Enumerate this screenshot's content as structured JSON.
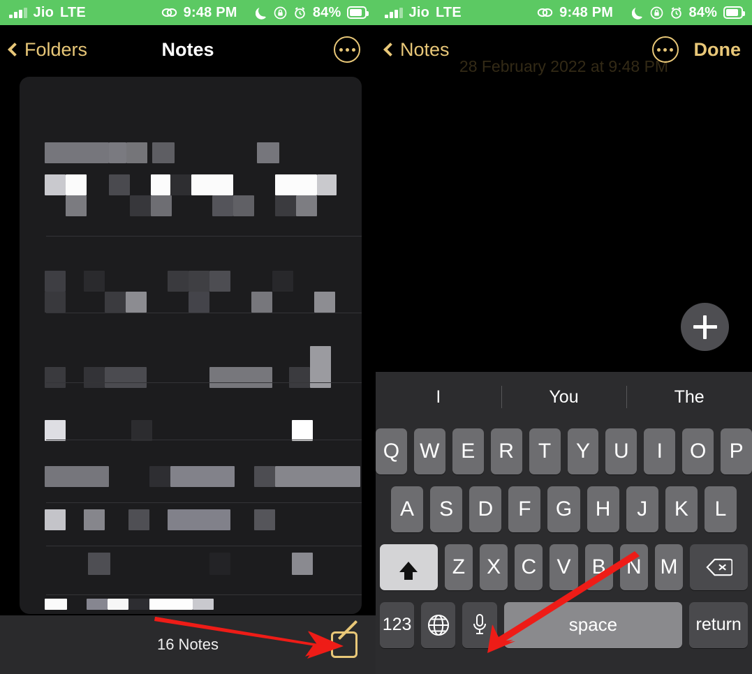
{
  "status_bar": {
    "carrier": "Jio",
    "network": "LTE",
    "time": "9:48 PM",
    "battery_percent": "84%",
    "battery_level": 84,
    "icons": [
      "signal-bars-icon",
      "link-icon",
      "moon-icon",
      "rotation-lock-icon",
      "alarm-icon",
      "battery-icon"
    ],
    "background_color": "#5cc963"
  },
  "left_pane": {
    "nav": {
      "back_label": "Folders",
      "title": "Notes",
      "more_icon": "more-options-icon"
    },
    "bottom": {
      "count_label": "16 Notes",
      "compose_icon": "compose-note-icon"
    },
    "note_rows": 9
  },
  "right_pane": {
    "nav": {
      "back_label": "Notes",
      "more_icon": "more-options-icon",
      "done_label": "Done"
    },
    "note_date": "28 February 2022 at 9:48 PM",
    "fab_icon": "add-icon"
  },
  "keyboard": {
    "suggestions": [
      "I",
      "You",
      "The"
    ],
    "row1": [
      "Q",
      "W",
      "E",
      "R",
      "T",
      "Y",
      "U",
      "I",
      "O",
      "P"
    ],
    "row2": [
      "A",
      "S",
      "D",
      "F",
      "G",
      "H",
      "J",
      "K",
      "L"
    ],
    "row3": [
      "Z",
      "X",
      "C",
      "V",
      "B",
      "N",
      "M"
    ],
    "shift_label": "shift",
    "delete_label": "delete",
    "numeric_label": "123",
    "globe_label": "next-keyboard",
    "dictation_label": "dictation",
    "space_label": "space",
    "return_label": "return",
    "shift_active": true
  },
  "annotations": {
    "arrow_color": "#ee1c17",
    "arrow_1_target": "compose-note-icon",
    "arrow_2_target": "dictation-key"
  },
  "colors": {
    "accent": "#e8c778",
    "status_green": "#5cc963",
    "list_bg": "#1c1c1e",
    "keyboard_bg": "#2c2c2e",
    "key_bg": "#6d6d70"
  },
  "blurred_blocks": [
    {
      "r": 0,
      "t": 46,
      "items": [
        [
          36,
          48,
          92,
          30,
          "#76767c"
        ],
        [
          128,
          48,
          25,
          30,
          "#7a7a80"
        ],
        [
          153,
          48,
          30,
          30,
          "#757579"
        ],
        [
          190,
          48,
          32,
          30,
          "#5e5e63"
        ],
        [
          340,
          48,
          32,
          30,
          "#76767c"
        ]
      ]
    },
    {
      "r": 0,
      "t": 0,
      "items": []
    },
    {
      "r": 1,
      "t": 140,
      "items": [
        [
          36,
          0,
          30,
          30,
          "#c9c9ce"
        ],
        [
          66,
          0,
          30,
          30,
          "#fbfbfb"
        ],
        [
          66,
          30,
          30,
          30,
          "#7b7b80"
        ],
        [
          128,
          0,
          30,
          30,
          "#4a4a4f"
        ],
        [
          158,
          30,
          30,
          30,
          "#37373b"
        ],
        [
          188,
          30,
          30,
          30,
          "#6e6e73"
        ],
        [
          188,
          0,
          28,
          30,
          "#fcfcfc"
        ],
        [
          216,
          0,
          30,
          30,
          "#2e2e31"
        ],
        [
          246,
          0,
          60,
          30,
          "#fbfbfb"
        ],
        [
          276,
          30,
          30,
          30,
          "#54545a"
        ],
        [
          306,
          30,
          30,
          30,
          "#606065"
        ],
        [
          366,
          0,
          60,
          30,
          "#fcfcfc"
        ],
        [
          426,
          0,
          28,
          30,
          "#c9c9cd"
        ],
        [
          366,
          30,
          30,
          30,
          "#3b3b3f"
        ],
        [
          396,
          30,
          30,
          30,
          "#7d7d82"
        ]
      ]
    },
    {
      "r": 2,
      "t": 278,
      "items": [
        [
          36,
          0,
          30,
          30,
          "#3e3e43"
        ],
        [
          36,
          30,
          30,
          30,
          "#39393d"
        ],
        [
          92,
          0,
          30,
          30,
          "#2a2a2d"
        ],
        [
          122,
          30,
          30,
          30,
          "#3b3b3f"
        ],
        [
          152,
          30,
          30,
          30,
          "#8c8c91"
        ],
        [
          212,
          0,
          30,
          30,
          "#3a3a3e"
        ],
        [
          242,
          0,
          30,
          30,
          "#3f3f43"
        ],
        [
          272,
          0,
          30,
          30,
          "#4d4d52"
        ],
        [
          242,
          30,
          30,
          30,
          "#44444a"
        ],
        [
          332,
          30,
          30,
          30,
          "#77777c"
        ],
        [
          362,
          0,
          30,
          30,
          "#28282b"
        ],
        [
          422,
          30,
          30,
          30,
          "#8d8d92"
        ]
      ]
    },
    {
      "r": 3,
      "t": 416,
      "items": [
        [
          36,
          0,
          30,
          30,
          "#3a3a3e"
        ],
        [
          92,
          0,
          30,
          30,
          "#333337"
        ],
        [
          122,
          0,
          60,
          30,
          "#4b4b50"
        ],
        [
          272,
          0,
          90,
          30,
          "#77777c"
        ],
        [
          386,
          0,
          30,
          30,
          "#3b3b3f"
        ],
        [
          416,
          -30,
          30,
          60,
          "#9b9ba0"
        ]
      ]
    },
    {
      "r": 4,
      "t": 492,
      "items": [
        [
          36,
          0,
          30,
          30,
          "#dedee3"
        ],
        [
          160,
          0,
          30,
          30,
          "#2c2c2f"
        ],
        [
          390,
          0,
          30,
          30,
          "#ffffff"
        ]
      ]
    },
    {
      "r": 5,
      "t": 558,
      "items": [
        [
          36,
          0,
          92,
          30,
          "#76767c"
        ],
        [
          186,
          0,
          30,
          30,
          "#2e2e32"
        ],
        [
          216,
          0,
          92,
          30,
          "#82828a"
        ],
        [
          336,
          0,
          30,
          30,
          "#4d4d52"
        ],
        [
          366,
          0,
          122,
          30,
          "#86868c"
        ]
      ]
    },
    {
      "r": 6,
      "t": 620,
      "items": [
        [
          36,
          0,
          30,
          30,
          "#c4c4c9"
        ],
        [
          92,
          0,
          30,
          30,
          "#86868c"
        ],
        [
          156,
          0,
          30,
          30,
          "#4f4f54"
        ],
        [
          212,
          0,
          90,
          30,
          "#81818a"
        ],
        [
          336,
          0,
          30,
          30,
          "#55555a"
        ]
      ]
    },
    {
      "r": 7,
      "t": 682,
      "items": [
        [
          98,
          0,
          32,
          32,
          "#4e4e53"
        ],
        [
          272,
          0,
          30,
          32,
          "#232326"
        ],
        [
          390,
          0,
          30,
          32,
          "#8a8a90"
        ]
      ]
    },
    {
      "r": 8,
      "t": 748,
      "items": [
        [
          36,
          0,
          32,
          16,
          "#fbfbfb"
        ],
        [
          96,
          0,
          30,
          16,
          "#868690"
        ],
        [
          126,
          0,
          30,
          16,
          "#f7f7f7"
        ],
        [
          156,
          0,
          30,
          16,
          "#2d2d31"
        ],
        [
          186,
          0,
          62,
          16,
          "#fdfdfd"
        ],
        [
          248,
          0,
          30,
          16,
          "#c9c9ce"
        ]
      ]
    },
    {
      "r": 9,
      "t": 788,
      "items": [
        [
          36,
          0,
          92,
          26,
          "#7c7c83"
        ],
        [
          126,
          0,
          30,
          26,
          "#3b3b3f"
        ],
        [
          176,
          0,
          60,
          26,
          "#70707a"
        ],
        [
          236,
          0,
          30,
          26,
          "#34343a"
        ],
        [
          296,
          0,
          30,
          26,
          "#2c2c30"
        ],
        [
          326,
          0,
          30,
          26,
          "#8c8c94"
        ]
      ]
    }
  ]
}
